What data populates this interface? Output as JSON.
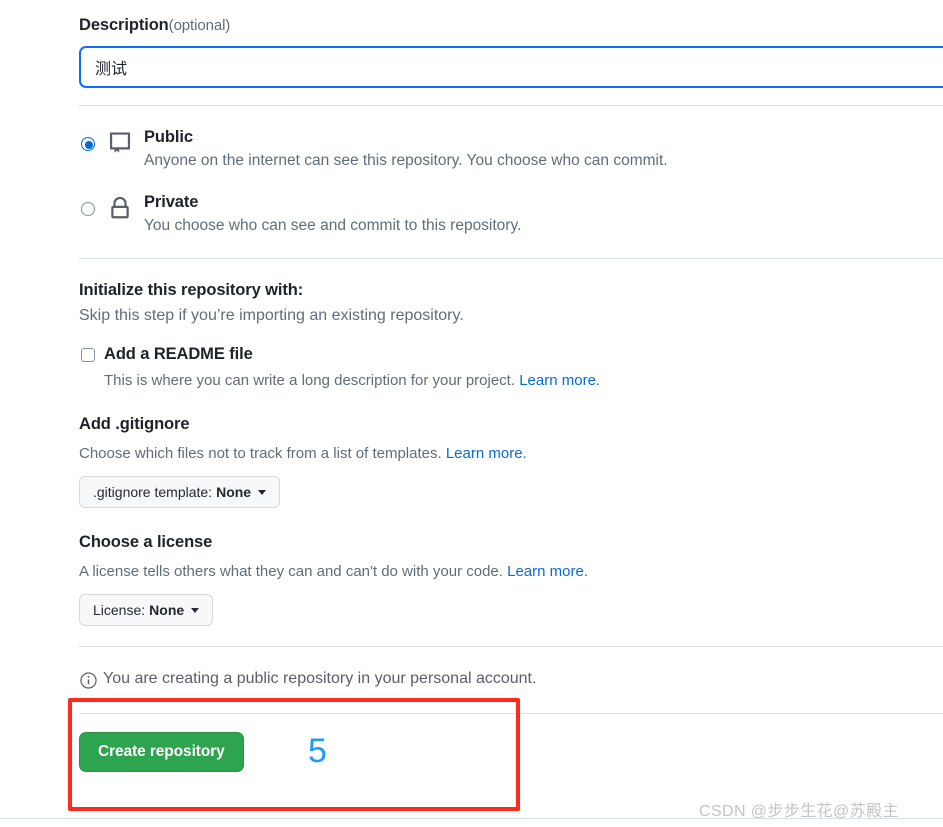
{
  "description_field": {
    "label": "Description",
    "optional_note": "(optional)",
    "value": "测试",
    "placeholder": ""
  },
  "visibility": {
    "options": [
      {
        "id": "public",
        "icon": "repo-book-icon",
        "title": "Public",
        "description": "Anyone on the internet can see this repository. You choose who can commit.",
        "selected": true
      },
      {
        "id": "private",
        "icon": "lock-icon",
        "title": "Private",
        "description": "You choose who can see and commit to this repository.",
        "selected": false
      }
    ]
  },
  "initialize": {
    "heading": "Initialize this repository with:",
    "subtext": "Skip this step if you’re importing an existing repository.",
    "readme": {
      "label": "Add a README file",
      "description": "This is where you can write a long description for your project.",
      "learn_more": "Learn more.",
      "checked": false
    }
  },
  "gitignore": {
    "heading": "Add .gitignore",
    "description": "Choose which files not to track from a list of templates.",
    "learn_more": "Learn more.",
    "select_prefix": ".gitignore template:",
    "select_value": "None"
  },
  "license": {
    "heading": "Choose a license",
    "description": "A license tells others what they can and can't do with your code.",
    "learn_more": "Learn more.",
    "select_prefix": "License:",
    "select_value": "None"
  },
  "notice": {
    "icon": "info-icon",
    "text": "You are creating a public repository in your personal account."
  },
  "actions": {
    "create_label": "Create repository"
  },
  "annotations": {
    "step_number": "5",
    "box_color": "#fc2b1b",
    "number_color": "#1e9bf5"
  },
  "watermark": {
    "text": "CSDN @步步生花@苏殿主"
  },
  "colors": {
    "accent_blue": "#0969da",
    "green_button": "#2da44e",
    "muted_text": "#636c76",
    "divider": "#d8dee4"
  }
}
